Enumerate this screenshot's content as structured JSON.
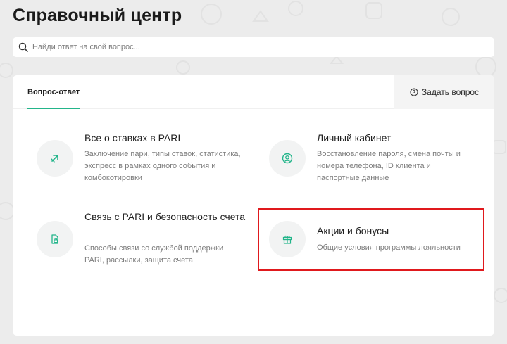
{
  "page": {
    "title": "Справочный центр"
  },
  "search": {
    "placeholder": "Найди ответ на свой вопрос..."
  },
  "tabs": {
    "active_label": "Вопрос-ответ",
    "ask_button_label": "Задать вопрос"
  },
  "colors": {
    "accent": "#23b58a",
    "highlight_border": "#e0191d",
    "background": "#ececec"
  },
  "categories": [
    {
      "title": "Все о ставках в PARI",
      "description": "Заключение пари, типы ставок, статистика, экспресс в рамках одного события и комбокотировки",
      "icon": "arrow-up-right-icon"
    },
    {
      "title": "Личный кабинет",
      "description": "Восстановление пароля, смена почты и номера телефона, ID клиента и паспортные данные",
      "icon": "user-circle-icon"
    },
    {
      "title": "Связь с PARI и безопасность счета",
      "description": "Способы связи со службой поддержки PARI, рассылки, защита счета",
      "icon": "document-lock-icon"
    },
    {
      "title": "Акции и бонусы",
      "description": "Общие условия программы лояльности",
      "icon": "gift-icon"
    }
  ]
}
